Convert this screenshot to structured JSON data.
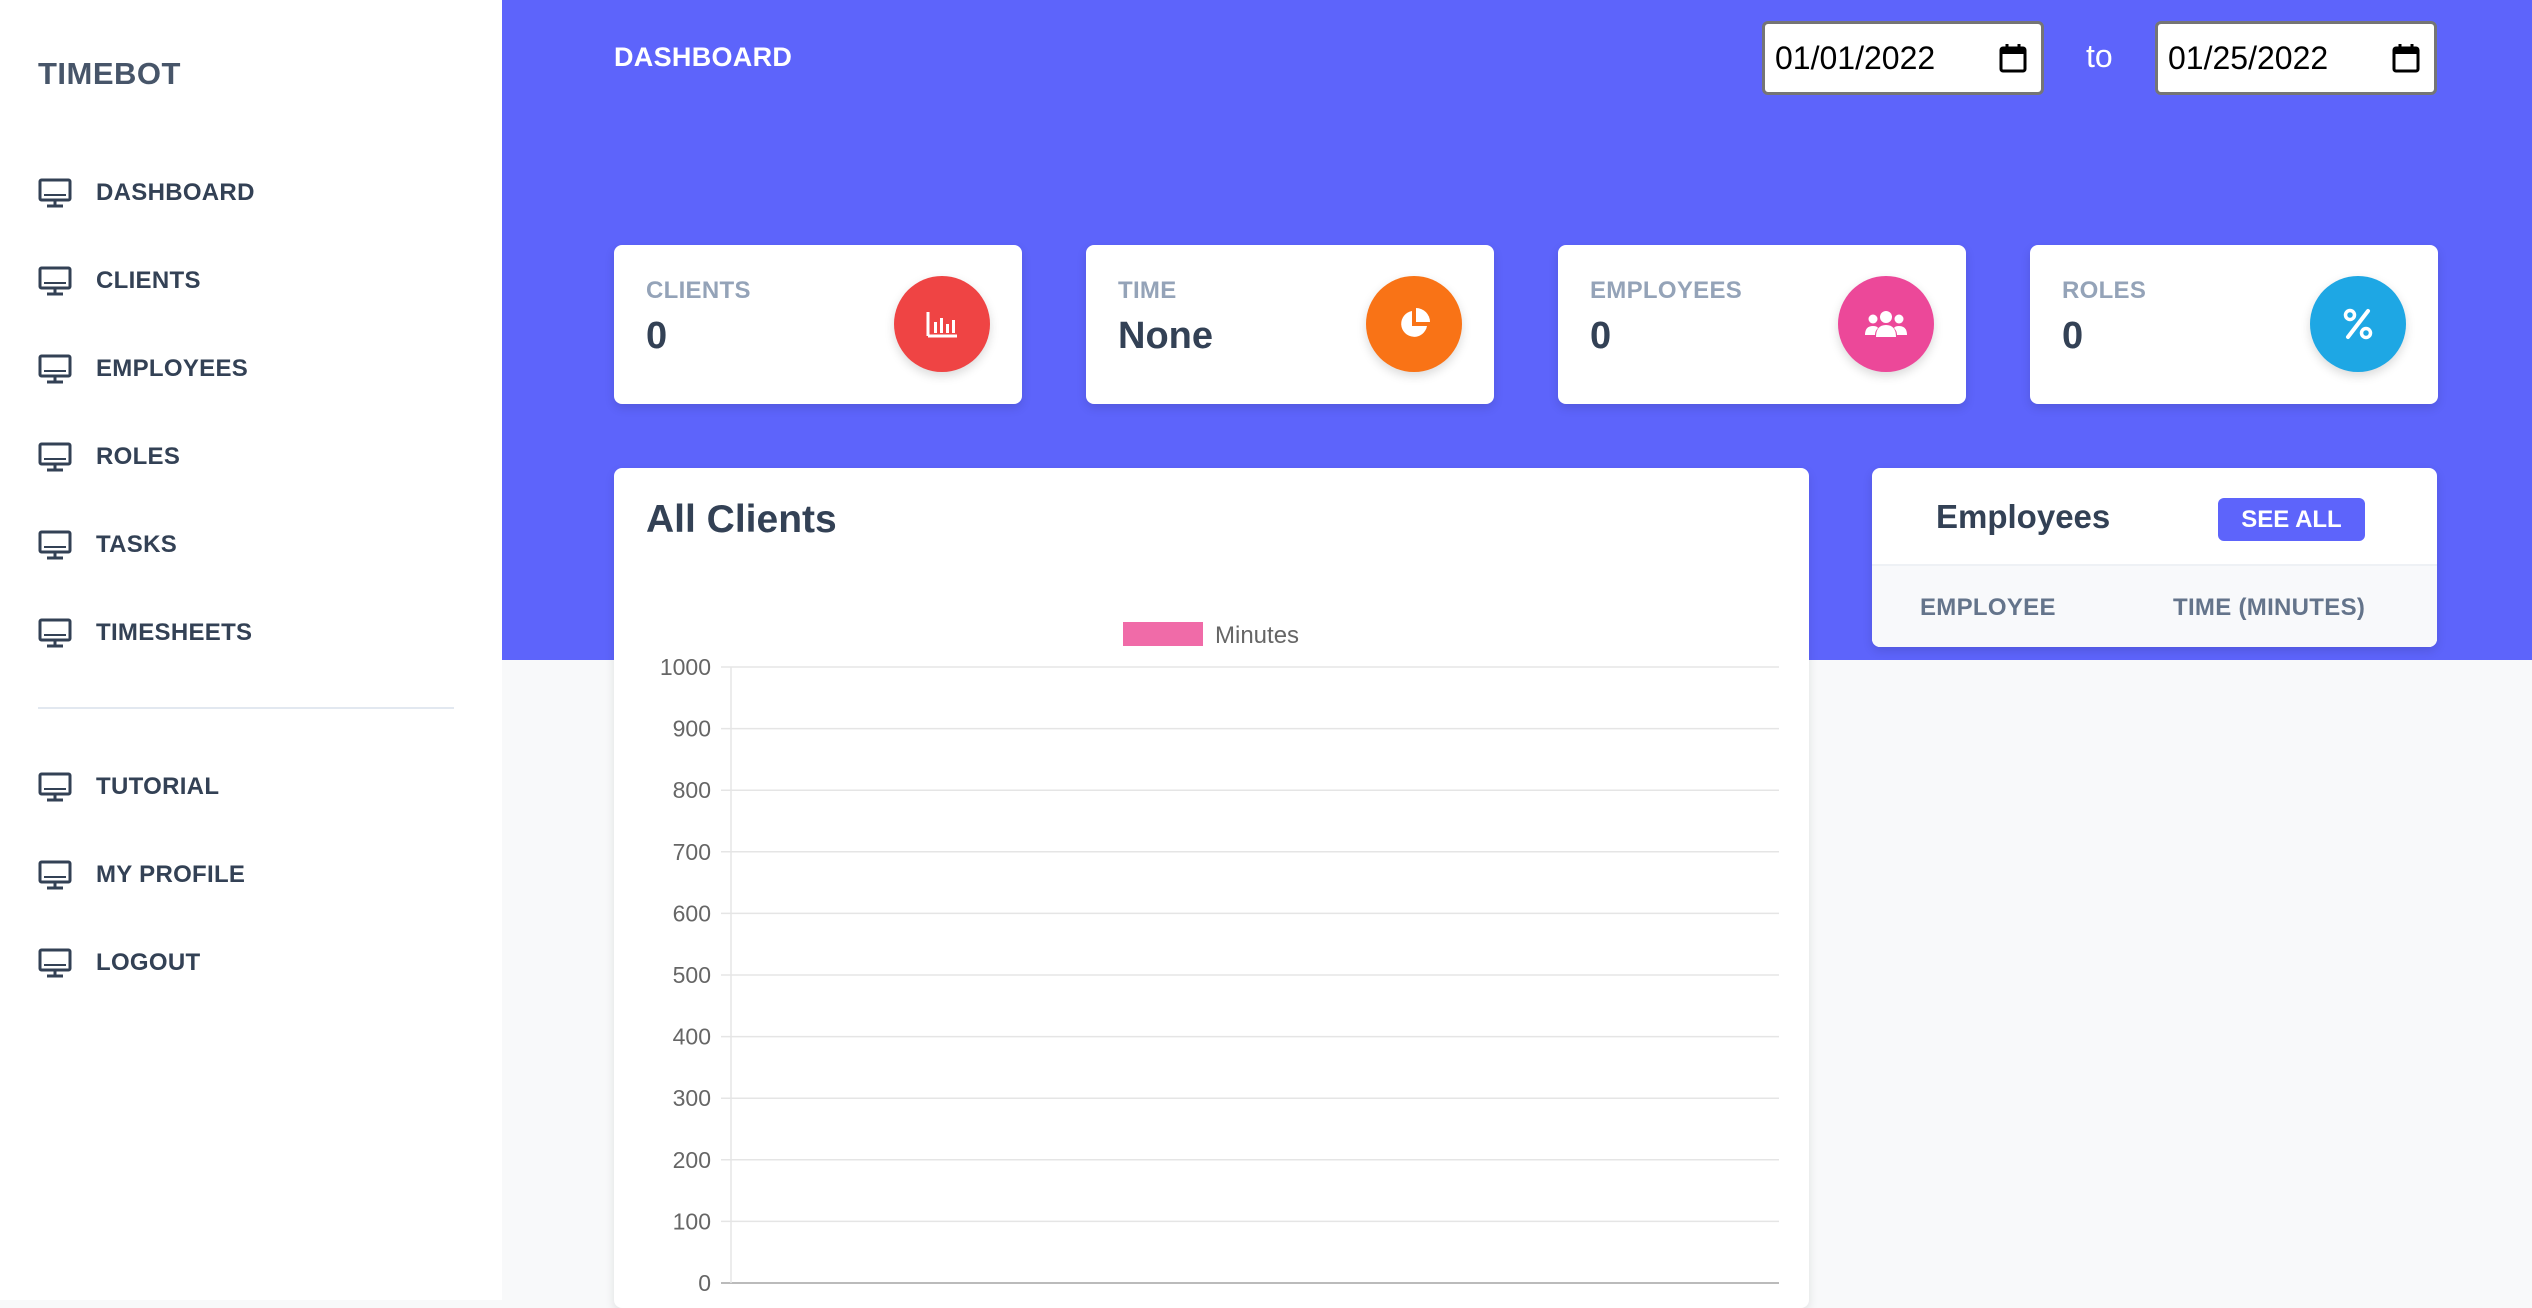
{
  "sidebar": {
    "brand": "TIMEBOT",
    "items": [
      {
        "label": "DASHBOARD",
        "icon": "monitor-icon"
      },
      {
        "label": "CLIENTS",
        "icon": "monitor-icon"
      },
      {
        "label": "EMPLOYEES",
        "icon": "monitor-icon"
      },
      {
        "label": "ROLES",
        "icon": "monitor-icon"
      },
      {
        "label": "TASKS",
        "icon": "monitor-icon"
      },
      {
        "label": "TIMESHEETS",
        "icon": "monitor-icon"
      }
    ],
    "secondary_items": [
      {
        "label": "TUTORIAL",
        "icon": "monitor-icon"
      },
      {
        "label": "MY PROFILE",
        "icon": "monitor-icon"
      },
      {
        "label": "LOGOUT",
        "icon": "monitor-icon"
      }
    ]
  },
  "header": {
    "title": "DASHBOARD",
    "date_from": "01/01/2022",
    "to_label": "to",
    "date_to": "01/25/2022",
    "accent_color": "#5d64fb"
  },
  "stats": [
    {
      "label": "CLIENTS",
      "value": "0",
      "icon": "bar-chart-icon",
      "color": "#ef4444"
    },
    {
      "label": "TIME",
      "value": "None",
      "icon": "pie-chart-icon",
      "color": "#f97316"
    },
    {
      "label": "EMPLOYEES",
      "value": "0",
      "icon": "users-icon",
      "color": "#ec4899"
    },
    {
      "label": "ROLES",
      "value": "0",
      "icon": "percent-icon",
      "color": "#1ea7e4"
    }
  ],
  "clients_panel": {
    "title": "All Clients"
  },
  "chart_data": {
    "type": "bar",
    "title": "",
    "categories": [],
    "series": [
      {
        "name": "Minutes",
        "values": [],
        "color": "#f06ba8"
      }
    ],
    "xlabel": "",
    "ylabel": "",
    "ylim": [
      0,
      1000
    ],
    "yticks": [
      0,
      100,
      200,
      300,
      400,
      500,
      600,
      700,
      800,
      900,
      1000
    ],
    "grid": true,
    "legend": "top-center"
  },
  "employees_panel": {
    "title": "Employees",
    "see_all_label": "SEE ALL",
    "columns": [
      "EMPLOYEE",
      "TIME (MINUTES)"
    ],
    "rows": []
  }
}
